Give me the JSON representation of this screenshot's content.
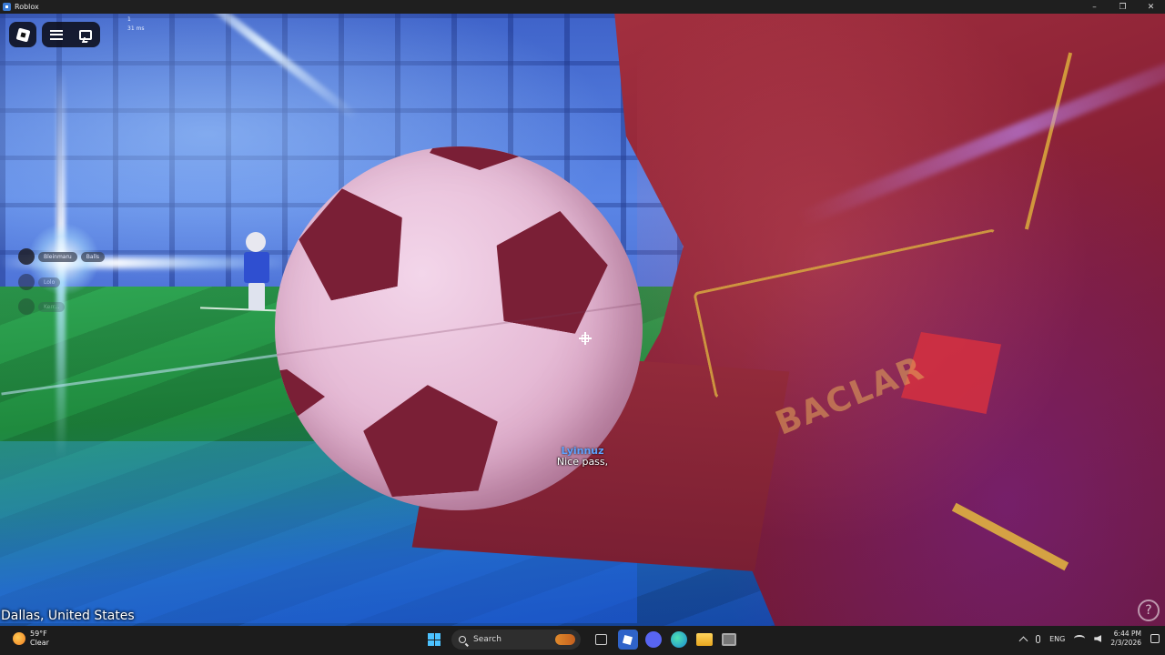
{
  "window": {
    "title": "Roblox",
    "controls": [
      "minimize-icon",
      "restore-icon",
      "close-icon"
    ]
  },
  "game": {
    "stats": [
      "1",
      "31 ms"
    ],
    "players": [
      {
        "name": "Bleinmaru",
        "tag": "Balls"
      },
      {
        "name": "Lolo",
        "tag": ""
      },
      {
        "name": "Kerr...",
        "tag": ""
      }
    ],
    "bubble_chat": {
      "speaker": "Lyinnuz",
      "message": "Nice pass,"
    },
    "jersey_text": "BACLAR",
    "location": "Dallas, United States",
    "help_label": "?"
  },
  "taskbar": {
    "weather_temp": "59°F",
    "weather_desc": "Clear",
    "search_placeholder": "Search",
    "language": "ENG",
    "time": "6:44 PM",
    "date": "2/3/2026"
  }
}
